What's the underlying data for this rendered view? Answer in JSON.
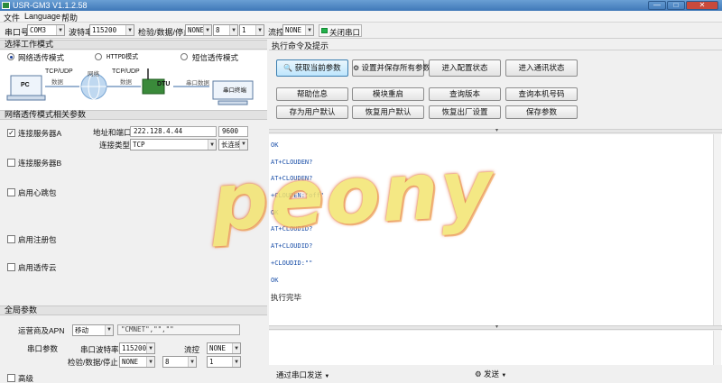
{
  "window": {
    "title": "USR-GM3 V1.1.2.58",
    "btn_min": "—",
    "btn_max": "□",
    "btn_close": "✕"
  },
  "menu": {
    "file": "文件",
    "language": "Language",
    "help": "帮助"
  },
  "toolbar": {
    "port_label": "串口号",
    "port_value": "COM3",
    "baud_label": "波特率",
    "baud_value": "115200",
    "parity_label": "检验/数据/停止",
    "parity_value": "NONE",
    "data_value": "8",
    "stop_value": "1",
    "flow_label": "流控",
    "flow_value": "NONE",
    "close_port_label": "关闭串口",
    "status_color": "#22b14c"
  },
  "mode_section": {
    "title": "选择工作模式",
    "modes": [
      "网络透传模式",
      "HTTPD模式",
      "短信透传模式"
    ],
    "selected": "网络透传模式",
    "diagram": {
      "pc": "PC",
      "tcp1": "TCP/UDP",
      "data1": "数据",
      "net": "网络",
      "tcp2": "TCP/UDP",
      "data2": "数据",
      "dtu": "DTU",
      "serial": "串口数据",
      "terminal": "串口终端"
    }
  },
  "net_params": {
    "title": "网络透传模式相关参数",
    "server_a": "连接服务器A",
    "server_a_checked": true,
    "addr_port_label": "地址和端口",
    "addr_value": "222.128.4.44",
    "port_value": "9600",
    "conn_type_label": "连接类型",
    "conn_type_value": "TCP",
    "conn_mode_value": "长连接",
    "server_b": "连接服务器B",
    "heartbeat": "启用心跳包",
    "register": "启用注册包",
    "cloud": "启用透传云"
  },
  "global": {
    "title": "全局参数",
    "apn_label": "运营商及APN",
    "apn_value": "移动",
    "apn_string": "\"CMNET\",\"\",\"\"",
    "serial_label": "串口参数",
    "serial_baud_label": "串口波特率",
    "serial_baud_value": "115200",
    "flow_label": "流控",
    "flow_value": "NONE",
    "parity_label": "检验/数据/停止",
    "parity_value": "NONE",
    "data_value": "8",
    "stop_value": "1",
    "advanced": "高级"
  },
  "commands": {
    "title": "执行命令及提示",
    "btn_get": "获取当前参数",
    "btn_set_save": "设置并保存所有参数",
    "btn_config": "进入配置状态",
    "btn_comm": "进入通讯状态",
    "btn_help": "帮助信息",
    "btn_restart": "模块重启",
    "btn_version": "查询版本",
    "btn_phone": "查询本机号码",
    "btn_save_default": "存为用户默认",
    "btn_restore_default": "恢复用户默认",
    "btn_factory": "恢复出厂设置",
    "btn_save_params": "保存参数"
  },
  "log": {
    "lines": [
      "OK",
      "AT+CLOUDEN?",
      "AT+CLOUDEN?",
      "+CLOUDEN:\"off\"",
      "OK",
      "AT+CLOUDID?",
      "AT+CLOUDID?",
      "+CLOUDID:\"\"",
      "OK"
    ],
    "done": "执行完毕"
  },
  "send": {
    "via_label": "通过串口发送",
    "send_label": "发送"
  },
  "watermark": "peony"
}
